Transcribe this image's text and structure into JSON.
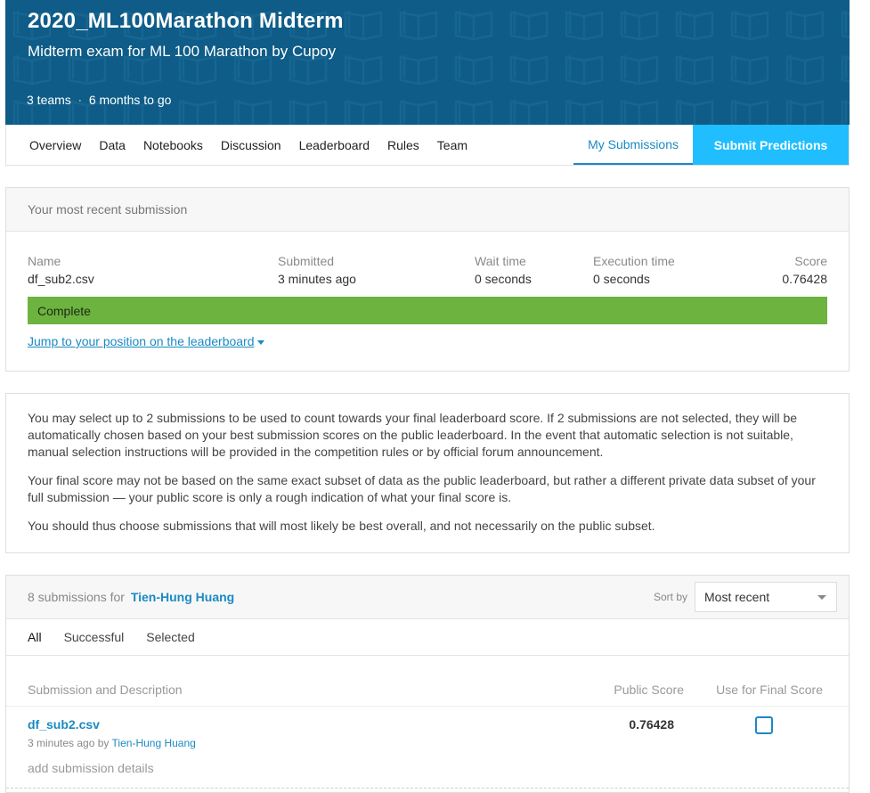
{
  "banner": {
    "title": "2020_ML100Marathon Midterm",
    "subtitle": "Midterm exam for ML 100 Marathon by Cupoy",
    "teams": "3 teams",
    "separator": "·",
    "deadline": "6 months to go",
    "pattern_icon": "book-icon",
    "background_color": "#0e5c87"
  },
  "nav": {
    "items": [
      "Overview",
      "Data",
      "Notebooks",
      "Discussion",
      "Leaderboard",
      "Rules",
      "Team"
    ],
    "active": "My Submissions",
    "submit": "Submit Predictions",
    "accent_color": "#20beff"
  },
  "recent": {
    "header": "Your most recent submission",
    "columns": {
      "name_label": "Name",
      "name_value": "df_sub2.csv",
      "submitted_label": "Submitted",
      "submitted_value": "3 minutes ago",
      "wait_label": "Wait time",
      "wait_value": "0 seconds",
      "exec_label": "Execution time",
      "exec_value": "0 seconds",
      "score_label": "Score",
      "score_value": "0.76428"
    },
    "status": "Complete",
    "status_color": "#6cb33f",
    "jump_link": "Jump to your position on the leaderboard"
  },
  "info": {
    "p1": "You may select up to 2 submissions to be used to count towards your final leaderboard score. If 2 submissions are not selected, they will be automatically chosen based on your best submission scores on the public leaderboard. In the event that automatic selection is not suitable, manual selection instructions will be provided in the competition rules or by official forum announcement.",
    "p2": "Your final score may not be based on the same exact subset of data as the public leaderboard, but rather a different private data subset of your full submission — your public score is only a rough indication of what your final score is.",
    "p3": "You should thus choose submissions that will most likely be best overall, and not necessarily on the public subset."
  },
  "submissions": {
    "count_text": "8 submissions for",
    "user": "Tien-Hung Huang",
    "sort_label": "Sort by",
    "sort_value": "Most recent",
    "tabs": [
      "All",
      "Successful",
      "Selected"
    ],
    "headers": {
      "desc": "Submission and Description",
      "public": "Public Score",
      "final": "Use for Final Score"
    },
    "rows": [
      {
        "file": "df_sub2.csv",
        "time": "3 minutes ago",
        "by": "by",
        "user": "Tien-Hung Huang",
        "details": "add submission details",
        "score": "0.76428"
      }
    ]
  }
}
